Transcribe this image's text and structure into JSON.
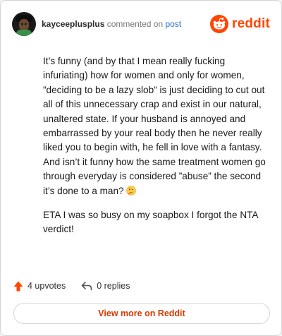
{
  "header": {
    "username": "kayceeplusplus",
    "action_text": "commented on",
    "link_text": "post",
    "brand": "reddit"
  },
  "comment": {
    "paragraph_1": "It’s funny (and by that I mean really fucking infuriating) how for women and only for women, ”deciding to be a lazy slob” is just deciding to cut out all of this unnecessary crap and exist in our natural, unaltered state. If your husband is annoyed and embarrassed by your real body then he never really liked you to begin with, he fell in love with a fantasy. And isn’t it funny how the same treatment women go through everyday is considered ”abuse” the second it’s done to a man?",
    "paragraph_1_emoji": "thinking-face-emoji",
    "paragraph_2": "ETA I was so busy on my soapbox I forgot the NTA verdict!"
  },
  "actions": {
    "upvotes_label": "4 upvotes",
    "replies_label": "0 replies"
  },
  "footer": {
    "view_more_label": "View more on Reddit"
  },
  "colors": {
    "brand": "#ff4500",
    "link": "#1f6fd1",
    "view_more": "#d93a00"
  }
}
